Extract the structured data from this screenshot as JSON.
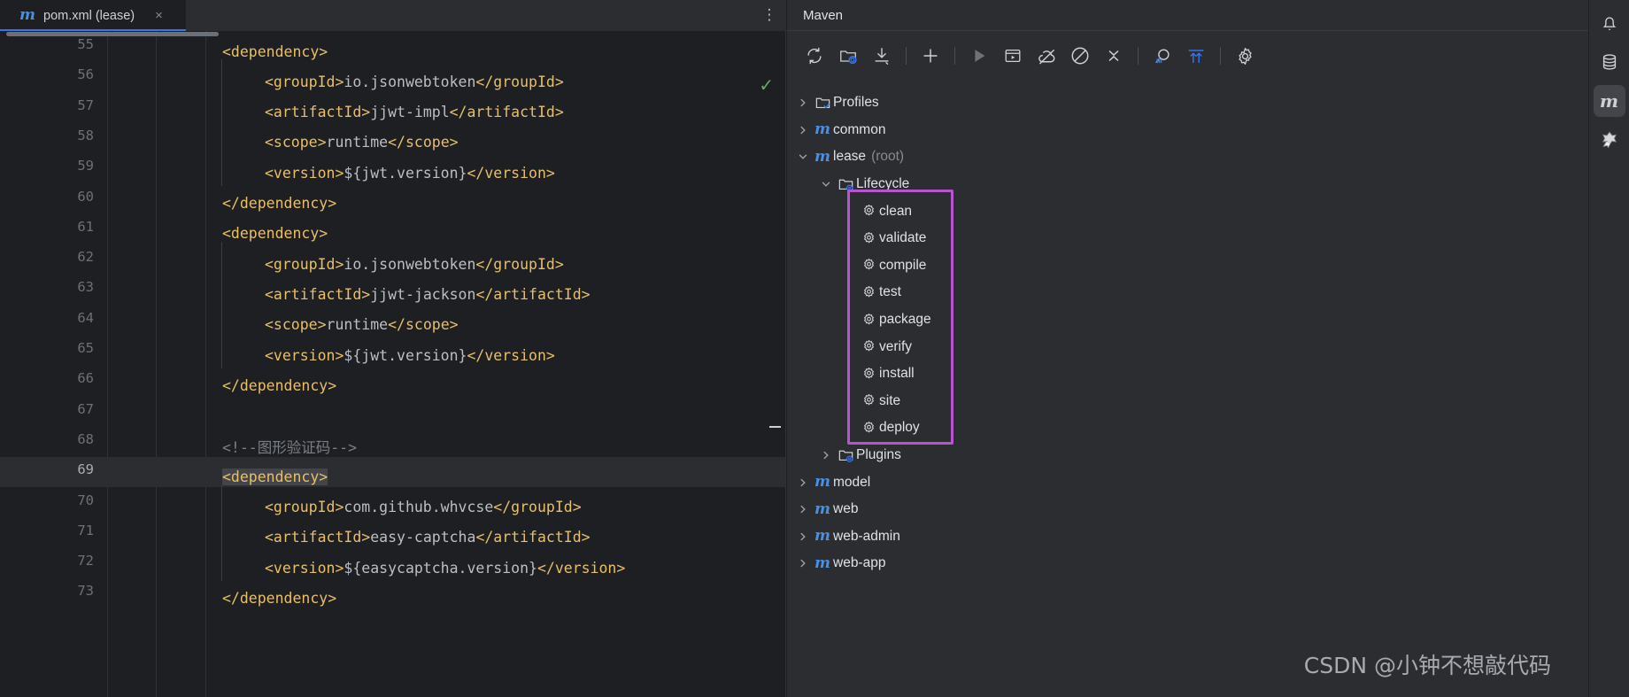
{
  "editor": {
    "tab": {
      "icon": "maven-m-icon",
      "title": "pom.xml (lease)",
      "close": "×"
    },
    "more_menu": "⋮",
    "inspection_status": "✓",
    "first_line_number": 55,
    "lines": [
      {
        "num": "55",
        "indent": 0,
        "tokens": [
          {
            "t": "tag",
            "v": "<dependency>"
          }
        ]
      },
      {
        "num": "56",
        "indent": 1,
        "tokens": [
          {
            "t": "tag",
            "v": "<groupId>"
          },
          {
            "t": "text",
            "v": "io.jsonwebtoken"
          },
          {
            "t": "tag",
            "v": "</groupId>"
          }
        ]
      },
      {
        "num": "57",
        "indent": 1,
        "tokens": [
          {
            "t": "tag",
            "v": "<artifactId>"
          },
          {
            "t": "text",
            "v": "jjwt-impl"
          },
          {
            "t": "tag",
            "v": "</artifactId>"
          }
        ]
      },
      {
        "num": "58",
        "indent": 1,
        "tokens": [
          {
            "t": "tag",
            "v": "<scope>"
          },
          {
            "t": "text",
            "v": "runtime"
          },
          {
            "t": "tag",
            "v": "</scope>"
          }
        ]
      },
      {
        "num": "59",
        "indent": 1,
        "tokens": [
          {
            "t": "tag",
            "v": "<version>"
          },
          {
            "t": "text",
            "v": "${jwt.version}"
          },
          {
            "t": "tag",
            "v": "</version>"
          }
        ]
      },
      {
        "num": "60",
        "indent": 0,
        "tokens": [
          {
            "t": "tag",
            "v": "</dependency>"
          }
        ]
      },
      {
        "num": "61",
        "indent": 0,
        "tokens": [
          {
            "t": "tag",
            "v": "<dependency>"
          }
        ]
      },
      {
        "num": "62",
        "indent": 1,
        "tokens": [
          {
            "t": "tag",
            "v": "<groupId>"
          },
          {
            "t": "text",
            "v": "io.jsonwebtoken"
          },
          {
            "t": "tag",
            "v": "</groupId>"
          }
        ]
      },
      {
        "num": "63",
        "indent": 1,
        "tokens": [
          {
            "t": "tag",
            "v": "<artifactId>"
          },
          {
            "t": "text",
            "v": "jjwt-jackson"
          },
          {
            "t": "tag",
            "v": "</artifactId>"
          }
        ]
      },
      {
        "num": "64",
        "indent": 1,
        "tokens": [
          {
            "t": "tag",
            "v": "<scope>"
          },
          {
            "t": "text",
            "v": "runtime"
          },
          {
            "t": "tag",
            "v": "</scope>"
          }
        ]
      },
      {
        "num": "65",
        "indent": 1,
        "tokens": [
          {
            "t": "tag",
            "v": "<version>"
          },
          {
            "t": "text",
            "v": "${jwt.version}"
          },
          {
            "t": "tag",
            "v": "</version>"
          }
        ]
      },
      {
        "num": "66",
        "indent": 0,
        "tokens": [
          {
            "t": "tag",
            "v": "</dependency>"
          }
        ]
      },
      {
        "num": "67",
        "indent": 0,
        "tokens": []
      },
      {
        "num": "68",
        "indent": 0,
        "tokens": [
          {
            "t": "comment",
            "v": "<!--图形验证码-->"
          }
        ]
      },
      {
        "num": "69",
        "indent": 0,
        "current": true,
        "selected": true,
        "tokens": [
          {
            "t": "tag",
            "v": "<dependency>"
          }
        ]
      },
      {
        "num": "70",
        "indent": 1,
        "tokens": [
          {
            "t": "tag",
            "v": "<groupId>"
          },
          {
            "t": "text",
            "v": "com.github.whvcse"
          },
          {
            "t": "tag",
            "v": "</groupId>"
          }
        ]
      },
      {
        "num": "71",
        "indent": 1,
        "tokens": [
          {
            "t": "tag",
            "v": "<artifactId>"
          },
          {
            "t": "text",
            "v": "easy-captcha"
          },
          {
            "t": "tag",
            "v": "</artifactId>"
          }
        ]
      },
      {
        "num": "72",
        "indent": 1,
        "tokens": [
          {
            "t": "tag",
            "v": "<version>"
          },
          {
            "t": "text",
            "v": "${easycaptcha.version}"
          },
          {
            "t": "tag",
            "v": "</version>"
          }
        ]
      },
      {
        "num": "73",
        "indent": 0,
        "tokens": [
          {
            "t": "tag",
            "v": "</dependency>"
          }
        ]
      }
    ]
  },
  "maven": {
    "title": "Maven",
    "toolbar": [
      {
        "name": "reload-all-maven-projects-icon",
        "label": "Reload All Maven Projects"
      },
      {
        "name": "add-maven-project-icon",
        "label": "Add Maven Projects"
      },
      {
        "name": "download-sources-icon",
        "label": "Download Sources and Documentation"
      },
      {
        "name": "separator-1",
        "label": ""
      },
      {
        "name": "add-icon",
        "label": "Add"
      },
      {
        "name": "separator-2",
        "label": ""
      },
      {
        "name": "run-icon",
        "label": "Run Maven Build"
      },
      {
        "name": "execute-maven-goal-icon",
        "label": "Execute Maven Goal"
      },
      {
        "name": "toggle-offline-mode-icon",
        "label": "Toggle Offline Mode"
      },
      {
        "name": "toggle-skip-tests-icon",
        "label": "Toggle 'Skip Tests' Mode"
      },
      {
        "name": "collapse-all-icon",
        "label": "Collapse All"
      },
      {
        "name": "separator-3",
        "label": ""
      },
      {
        "name": "show-dependencies-icon",
        "label": "Show Dependencies"
      },
      {
        "name": "expand-ignored-icon",
        "label": "Show/Hide Ignored Projects"
      },
      {
        "name": "separator-4",
        "label": ""
      },
      {
        "name": "settings-gear-icon",
        "label": "Maven Settings"
      }
    ],
    "tree": [
      {
        "id": "profiles",
        "depth": 0,
        "twisty": "collapsed",
        "icon": "folder-check-icon",
        "label": "Profiles",
        "sub": ""
      },
      {
        "id": "common",
        "depth": 0,
        "twisty": "collapsed",
        "icon": "maven-module-icon",
        "label": "common",
        "sub": ""
      },
      {
        "id": "lease",
        "depth": 0,
        "twisty": "expanded",
        "icon": "maven-module-icon",
        "label": "lease",
        "sub": "(root)"
      },
      {
        "id": "lifecycle",
        "depth": 1,
        "twisty": "expanded",
        "icon": "folder-gear-icon",
        "label": "Lifecycle",
        "sub": ""
      },
      {
        "id": "clean",
        "depth": 2,
        "twisty": "none",
        "icon": "goal-gear-icon",
        "label": "clean",
        "sub": ""
      },
      {
        "id": "validate",
        "depth": 2,
        "twisty": "none",
        "icon": "goal-gear-icon",
        "label": "validate",
        "sub": ""
      },
      {
        "id": "compile",
        "depth": 2,
        "twisty": "none",
        "icon": "goal-gear-icon",
        "label": "compile",
        "sub": ""
      },
      {
        "id": "test",
        "depth": 2,
        "twisty": "none",
        "icon": "goal-gear-icon",
        "label": "test",
        "sub": ""
      },
      {
        "id": "package",
        "depth": 2,
        "twisty": "none",
        "icon": "goal-gear-icon",
        "label": "package",
        "sub": ""
      },
      {
        "id": "verify",
        "depth": 2,
        "twisty": "none",
        "icon": "goal-gear-icon",
        "label": "verify",
        "sub": ""
      },
      {
        "id": "install",
        "depth": 2,
        "twisty": "none",
        "icon": "goal-gear-icon",
        "label": "install",
        "sub": ""
      },
      {
        "id": "site",
        "depth": 2,
        "twisty": "none",
        "icon": "goal-gear-icon",
        "label": "site",
        "sub": ""
      },
      {
        "id": "deploy",
        "depth": 2,
        "twisty": "none",
        "icon": "goal-gear-icon",
        "label": "deploy",
        "sub": ""
      },
      {
        "id": "plugins",
        "depth": 1,
        "twisty": "collapsed",
        "icon": "folder-gear-icon",
        "label": "Plugins",
        "sub": ""
      },
      {
        "id": "model",
        "depth": 0,
        "twisty": "collapsed",
        "icon": "maven-module-icon",
        "label": "model",
        "sub": ""
      },
      {
        "id": "web",
        "depth": 0,
        "twisty": "collapsed",
        "icon": "maven-module-icon",
        "label": "web",
        "sub": ""
      },
      {
        "id": "web-admin",
        "depth": 0,
        "twisty": "collapsed",
        "icon": "maven-module-icon",
        "label": "web-admin",
        "sub": ""
      },
      {
        "id": "web-app",
        "depth": 0,
        "twisty": "collapsed",
        "icon": "maven-module-icon",
        "label": "web-app",
        "sub": ""
      }
    ],
    "highlight_color": "#B954D0",
    "highlight_first_item": "clean",
    "highlight_last_item": "deploy"
  },
  "right_stripe": [
    {
      "name": "notifications-bell-icon",
      "label": "Notifications",
      "active": false
    },
    {
      "name": "database-icon",
      "label": "Database",
      "active": false
    },
    {
      "name": "maven-m-icon",
      "label": "Maven",
      "active": true
    },
    {
      "name": "tomcat-icon",
      "label": "Tomcat Server",
      "active": false
    }
  ],
  "watermark": {
    "text": "CSDN @小钟不想敲代码"
  }
}
